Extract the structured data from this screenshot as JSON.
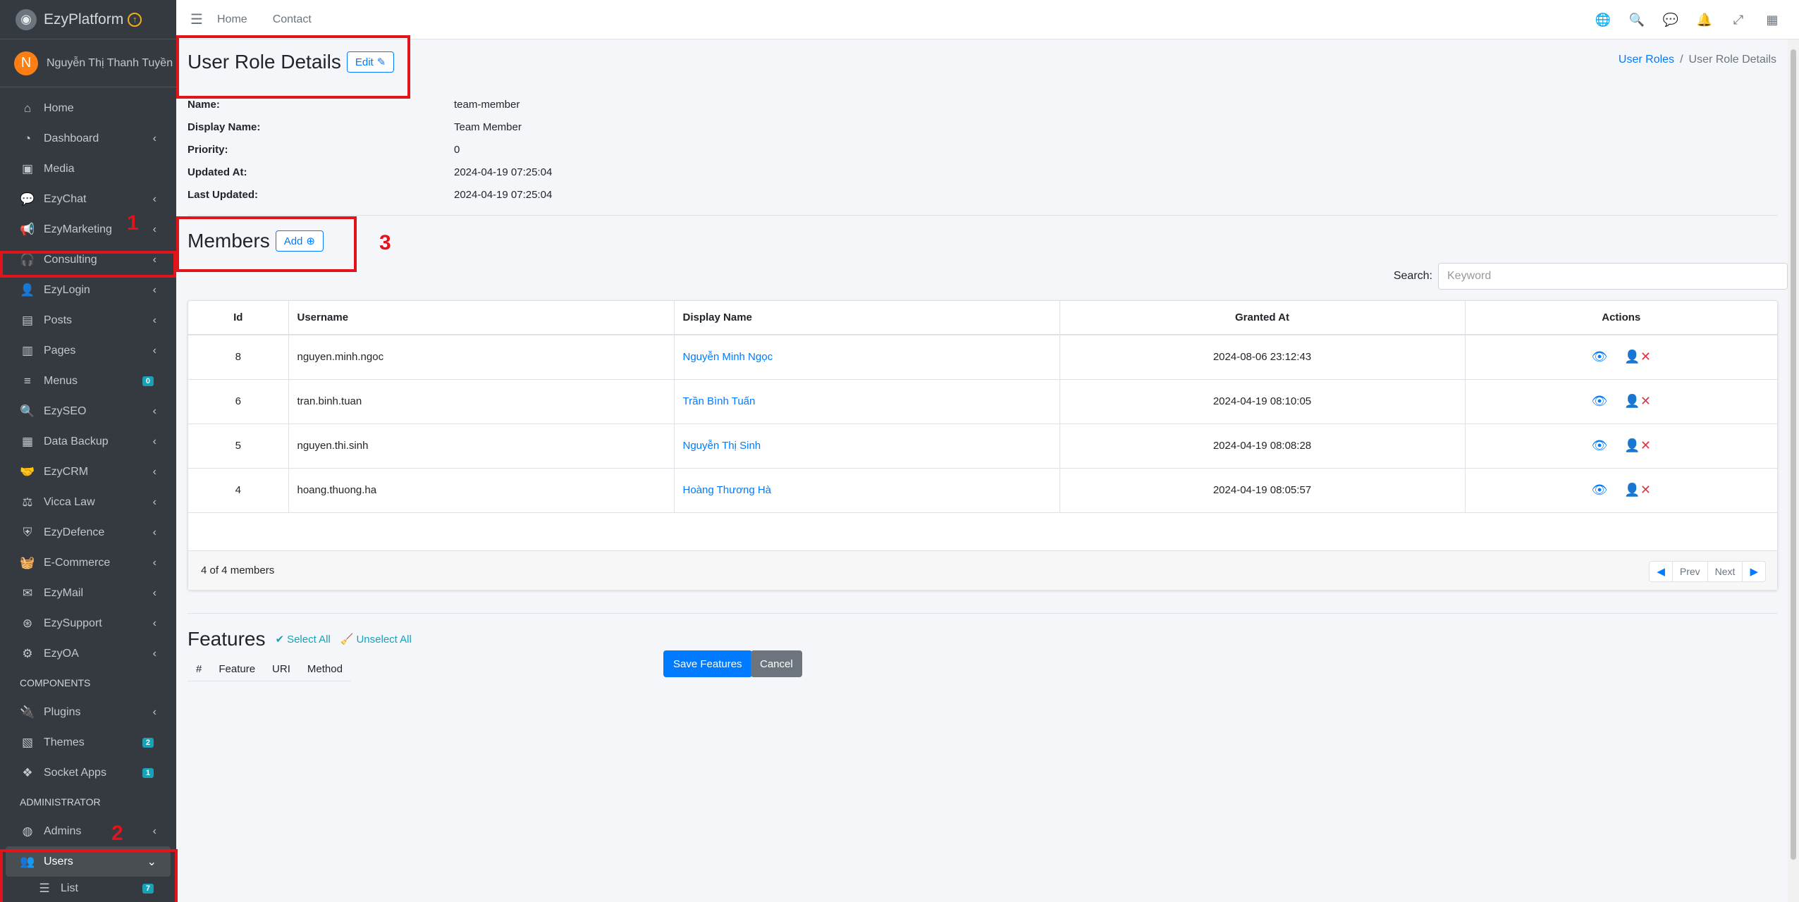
{
  "brand": {
    "name": "EzyPlatform",
    "logo_icon": "ezyplatform-logo-icon",
    "badge_icon": "arrow-up-circle-icon"
  },
  "user": {
    "initial": "N",
    "name": "Nguyễn Thị Thanh Tuyền"
  },
  "sidebar": {
    "items": [
      {
        "label": "Home",
        "icon": "home-icon"
      },
      {
        "label": "Dashboard",
        "icon": "dashboard-icon"
      },
      {
        "label": "Media",
        "icon": "image-icon"
      },
      {
        "label": "EzyChat",
        "icon": "chat-icon"
      },
      {
        "label": "EzyMarketing",
        "icon": "megaphone-icon"
      },
      {
        "label": "Consulting",
        "icon": "headset-icon"
      },
      {
        "label": "EzyLogin",
        "icon": "user-lock-icon"
      },
      {
        "label": "Posts",
        "icon": "posts-icon"
      },
      {
        "label": "Pages",
        "icon": "book-icon"
      },
      {
        "label": "Menus",
        "icon": "menu-icon",
        "badge": "0"
      },
      {
        "label": "EzySEO",
        "icon": "search-icon"
      },
      {
        "label": "Data Backup",
        "icon": "archive-icon"
      },
      {
        "label": "EzyCRM",
        "icon": "handshake-icon"
      },
      {
        "label": "Vicca Law",
        "icon": "gavel-icon"
      },
      {
        "label": "EzyDefence",
        "icon": "shield-icon"
      },
      {
        "label": "E-Commerce",
        "icon": "basket-icon"
      },
      {
        "label": "EzyMail",
        "icon": "envelope-icon"
      },
      {
        "label": "EzySupport",
        "icon": "lifebuoy-icon"
      },
      {
        "label": "EzyOA",
        "icon": "cog-icon"
      }
    ],
    "components_header": "COMPONENTS",
    "components": [
      {
        "label": "Plugins",
        "icon": "plug-icon"
      },
      {
        "label": "Themes",
        "icon": "themes-icon",
        "badge": "2"
      },
      {
        "label": "Socket Apps",
        "icon": "cubes-icon",
        "badge": "1"
      }
    ],
    "admin_header": "ADMINISTRATOR",
    "admin": [
      {
        "label": "Admins",
        "icon": "user-circle-icon"
      },
      {
        "label": "Users",
        "icon": "users-icon"
      },
      {
        "label": "List",
        "icon": "list-icon",
        "badge": "7"
      }
    ]
  },
  "topbar": {
    "home": "Home",
    "contact": "Contact"
  },
  "page": {
    "title": "User Role Details",
    "edit_label": "Edit"
  },
  "breadcrumb": {
    "parent": "User Roles",
    "current": "User Role Details"
  },
  "details": [
    {
      "label": "Name:",
      "value": "team-member"
    },
    {
      "label": "Display Name:",
      "value": "Team Member"
    },
    {
      "label": "Priority:",
      "value": "0"
    },
    {
      "label": "Updated At:",
      "value": "2024-04-19 07:25:04"
    },
    {
      "label": "Last Updated:",
      "value": "2024-04-19 07:25:04"
    }
  ],
  "members": {
    "title": "Members",
    "add_label": "Add",
    "search_label": "Search:",
    "search_placeholder": "Keyword",
    "columns": [
      "Id",
      "Username",
      "Display Name",
      "Granted At",
      "Actions"
    ],
    "rows": [
      {
        "id": "8",
        "username": "nguyen.minh.ngoc",
        "display_name": "Nguyễn Minh Ngọc",
        "granted_at": "2024-08-06 23:12:43"
      },
      {
        "id": "6",
        "username": "tran.binh.tuan",
        "display_name": "Trần Bình Tuấn",
        "granted_at": "2024-04-19 08:10:05"
      },
      {
        "id": "5",
        "username": "nguyen.thi.sinh",
        "display_name": "Nguyễn Thị Sinh",
        "granted_at": "2024-04-19 08:08:28"
      },
      {
        "id": "4",
        "username": "hoang.thuong.ha",
        "display_name": "Hoàng Thương Hà",
        "granted_at": "2024-04-19 08:05:57"
      }
    ],
    "summary": "4 of 4 members",
    "prev": "Prev",
    "next": "Next"
  },
  "features": {
    "title": "Features",
    "select_all": "Select All",
    "unselect_all": "Unselect All",
    "columns": [
      "#",
      "Feature",
      "URI",
      "Method"
    ],
    "save_label": "Save Features",
    "cancel_label": "Cancel"
  },
  "annotations": [
    "1",
    "2",
    "3"
  ],
  "colors": {
    "accent": "#007bff",
    "annotation": "#e1141c",
    "sidebar": "#343a40"
  }
}
